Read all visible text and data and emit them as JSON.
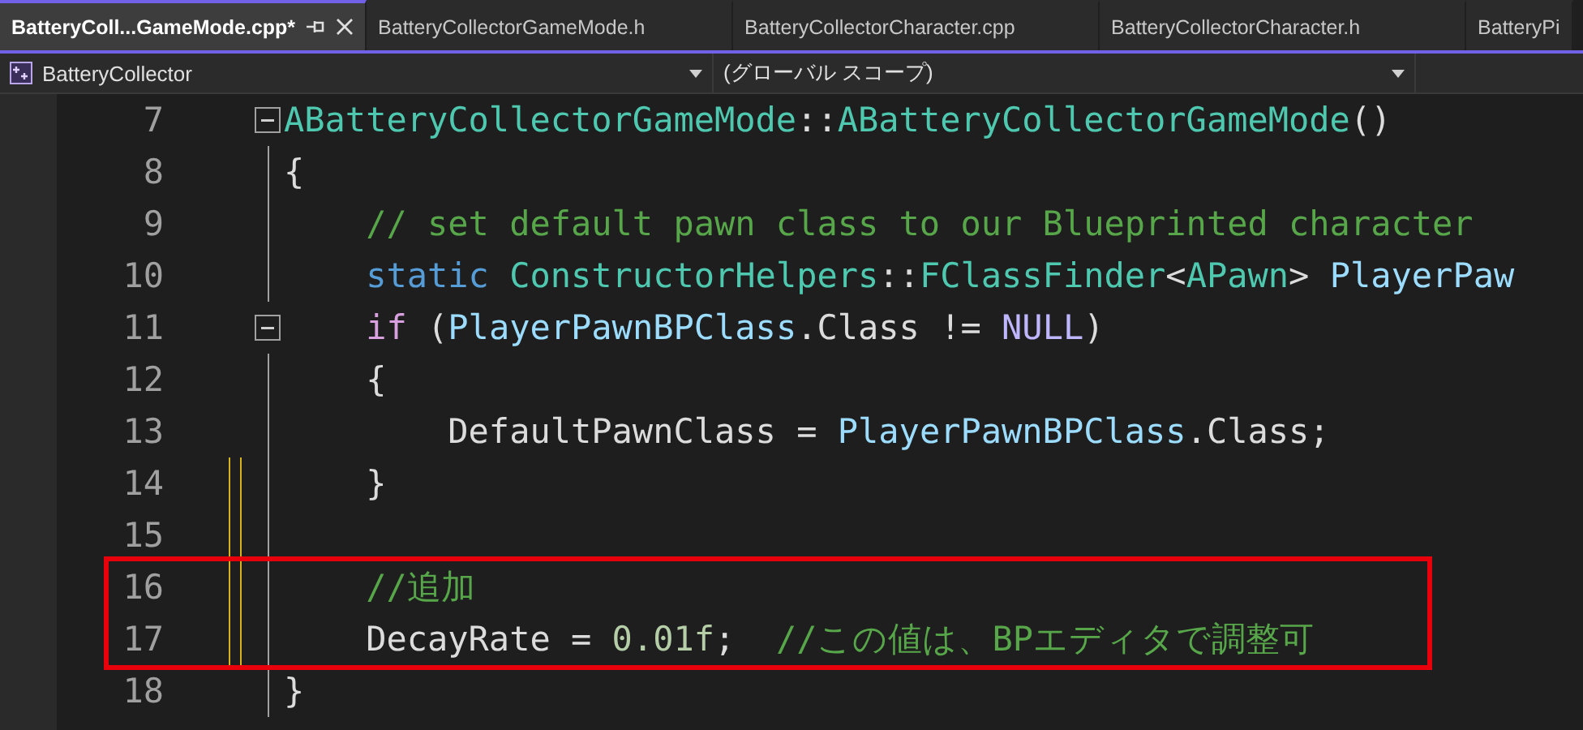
{
  "tabs": [
    {
      "label": "BatteryColl...GameMode.cpp*",
      "selected": true
    },
    {
      "label": "BatteryCollectorGameMode.h",
      "selected": false
    },
    {
      "label": "BatteryCollectorCharacter.cpp",
      "selected": false
    },
    {
      "label": "BatteryCollectorCharacter.h",
      "selected": false
    },
    {
      "label": "BatteryPi",
      "selected": false
    }
  ],
  "nav_bar": {
    "project": "BatteryCollector",
    "scope": "(グローバル スコープ)"
  },
  "code_lines": [
    {
      "number": "7",
      "fold": true,
      "changed": false,
      "highlighted": false,
      "tokens": [
        {
          "kind": "type",
          "text": "ABatteryCollectorGameMode"
        },
        {
          "kind": "plain",
          "text": "::"
        },
        {
          "kind": "type",
          "text": "ABatteryCollectorGameMode"
        },
        {
          "kind": "plain",
          "text": "()"
        }
      ]
    },
    {
      "number": "8",
      "fold": false,
      "changed": false,
      "highlighted": false,
      "tokens": [
        {
          "kind": "plain",
          "text": "{"
        }
      ]
    },
    {
      "number": "9",
      "fold": false,
      "changed": false,
      "highlighted": false,
      "tokens": [
        {
          "kind": "comment",
          "text": "    // set default pawn class to our Blueprinted character"
        }
      ]
    },
    {
      "number": "10",
      "fold": false,
      "changed": false,
      "highlighted": false,
      "tokens": [
        {
          "kind": "keyword",
          "text": "    static "
        },
        {
          "kind": "type",
          "text": "ConstructorHelpers"
        },
        {
          "kind": "plain",
          "text": "::"
        },
        {
          "kind": "type",
          "text": "FClassFinder"
        },
        {
          "kind": "plain",
          "text": "<"
        },
        {
          "kind": "type",
          "text": "APawn"
        },
        {
          "kind": "plain",
          "text": "> "
        },
        {
          "kind": "var",
          "text": "PlayerPaw"
        }
      ]
    },
    {
      "number": "11",
      "fold": true,
      "changed": false,
      "highlighted": false,
      "tokens": [
        {
          "kind": "control",
          "text": "    if"
        },
        {
          "kind": "plain",
          "text": " ("
        },
        {
          "kind": "var",
          "text": "PlayerPawnBPClass"
        },
        {
          "kind": "plain",
          "text": ".Class != "
        },
        {
          "kind": "macro",
          "text": "NULL"
        },
        {
          "kind": "plain",
          "text": ")"
        }
      ]
    },
    {
      "number": "12",
      "fold": false,
      "changed": false,
      "highlighted": false,
      "tokens": [
        {
          "kind": "plain",
          "text": "    {"
        }
      ]
    },
    {
      "number": "13",
      "fold": false,
      "changed": false,
      "highlighted": false,
      "tokens": [
        {
          "kind": "plain",
          "text": "        DefaultPawnClass = "
        },
        {
          "kind": "var",
          "text": "PlayerPawnBPClass"
        },
        {
          "kind": "plain",
          "text": ".Class;"
        }
      ]
    },
    {
      "number": "14",
      "fold": false,
      "changed": true,
      "highlighted": false,
      "tokens": [
        {
          "kind": "plain",
          "text": "    }"
        }
      ]
    },
    {
      "number": "15",
      "fold": false,
      "changed": true,
      "highlighted": false
    },
    {
      "number": "16",
      "fold": false,
      "changed": true,
      "highlighted": true,
      "tokens": [
        {
          "kind": "comment",
          "text": "    //追加"
        }
      ]
    },
    {
      "number": "17",
      "fold": false,
      "changed": true,
      "highlighted": true,
      "tokens": [
        {
          "kind": "plain",
          "text": "    DecayRate = "
        },
        {
          "kind": "number",
          "text": "0.01f"
        },
        {
          "kind": "plain",
          "text": ";  "
        },
        {
          "kind": "comment",
          "text": "//この値は、BPエディタで調整可"
        }
      ]
    },
    {
      "number": "18",
      "fold": false,
      "changed": false,
      "highlighted": false,
      "tokens": [
        {
          "kind": "plain",
          "text": "}"
        }
      ]
    }
  ]
}
